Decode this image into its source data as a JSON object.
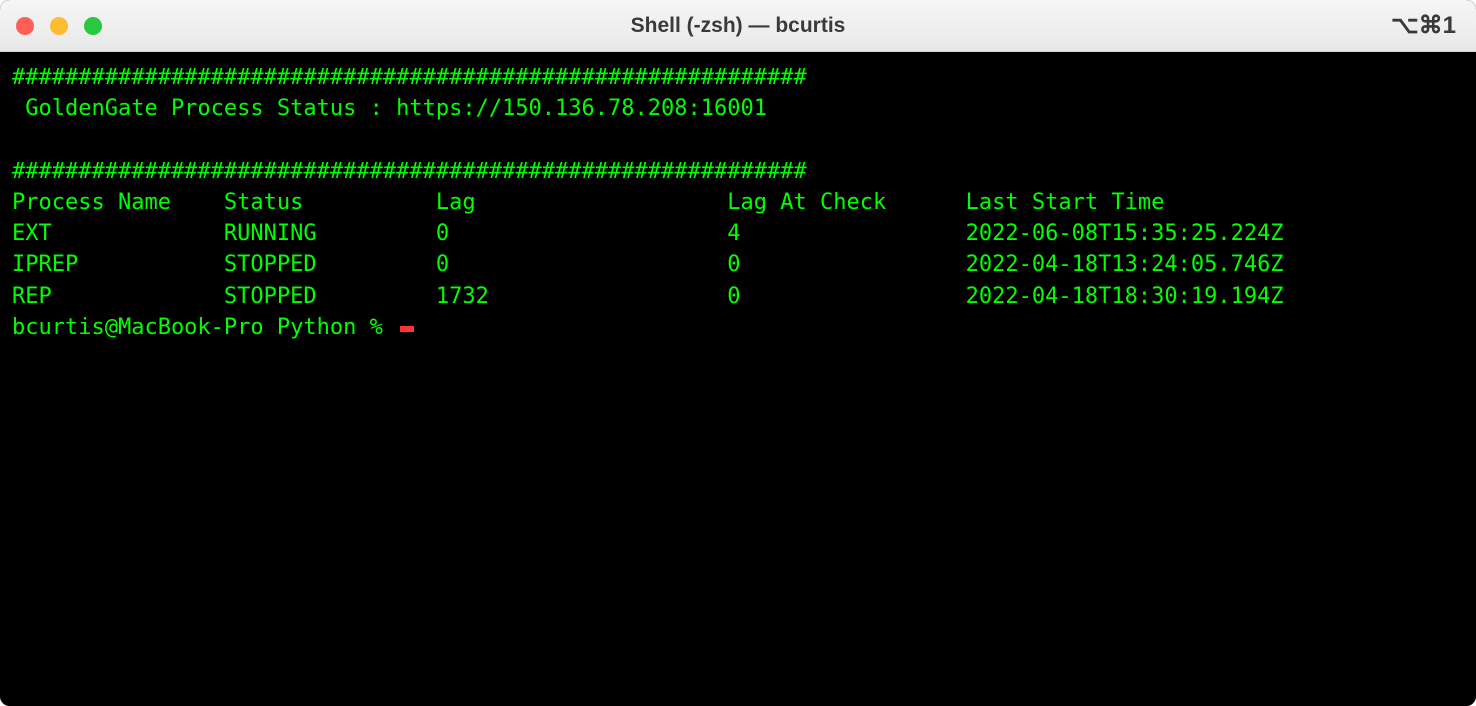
{
  "window": {
    "title": "Shell (-zsh) — bcurtis",
    "shortcut": "⌥⌘1"
  },
  "terminal": {
    "divider1": "############################################################",
    "header": " GoldenGate Process Status : https://150.136.78.208:16001",
    "divider2": "############################################################",
    "columns": {
      "name": "Process Name",
      "status": "Status",
      "lag": "Lag",
      "lagAtCheck": "Lag At Check",
      "lastStart": "Last Start Time"
    },
    "rows": [
      {
        "name": "EXT",
        "status": "RUNNING",
        "lag": "0",
        "lagAtCheck": "4",
        "lastStart": "2022-06-08T15:35:25.224Z"
      },
      {
        "name": "IPREP",
        "status": "STOPPED",
        "lag": "0",
        "lagAtCheck": "0",
        "lastStart": "2022-04-18T13:24:05.746Z"
      },
      {
        "name": "REP",
        "status": "STOPPED",
        "lag": "1732",
        "lagAtCheck": "0",
        "lastStart": "2022-04-18T18:30:19.194Z"
      }
    ],
    "prompt": "bcurtis@MacBook-Pro Python % "
  }
}
